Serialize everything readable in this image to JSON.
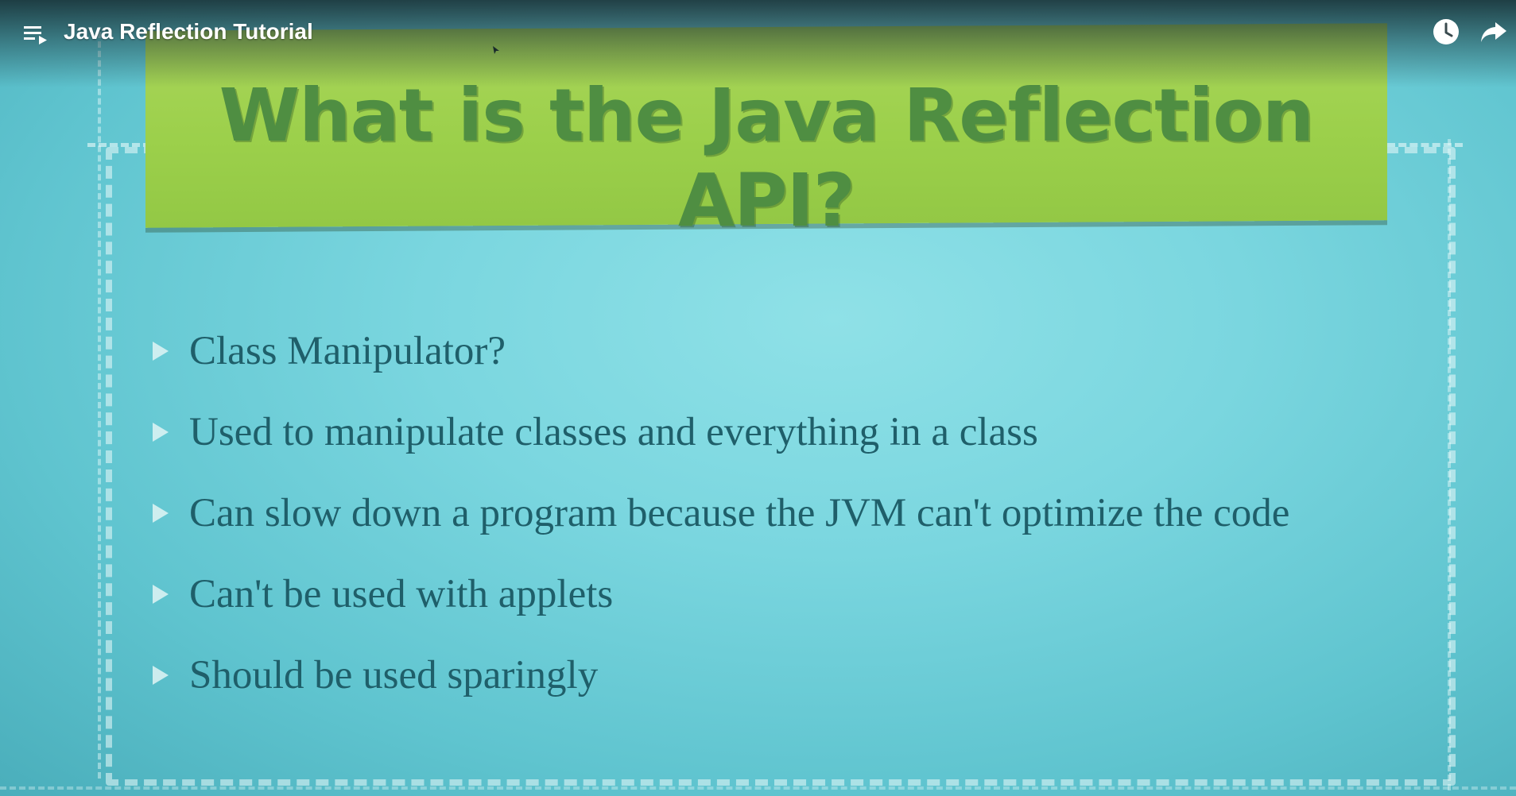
{
  "video": {
    "title": "Java Reflection Tutorial"
  },
  "controls": {
    "playlist_icon": "playlist-icon",
    "watch_later_icon": "clock-icon",
    "share_icon": "share-arrow-icon"
  },
  "slide": {
    "title": "What is the Java Reflection API?",
    "bullets": [
      "Class Manipulator?",
      "Used to manipulate classes and everything in a class",
      "Can slow down a program because the JVM can't optimize the code",
      "Can't be used with applets",
      "Should be used sparingly"
    ],
    "colors": {
      "background": "#7ad6df",
      "banner": "#9cd04b",
      "title_text": "#4f8e42",
      "bullet_text": "#1f5f6a"
    }
  }
}
